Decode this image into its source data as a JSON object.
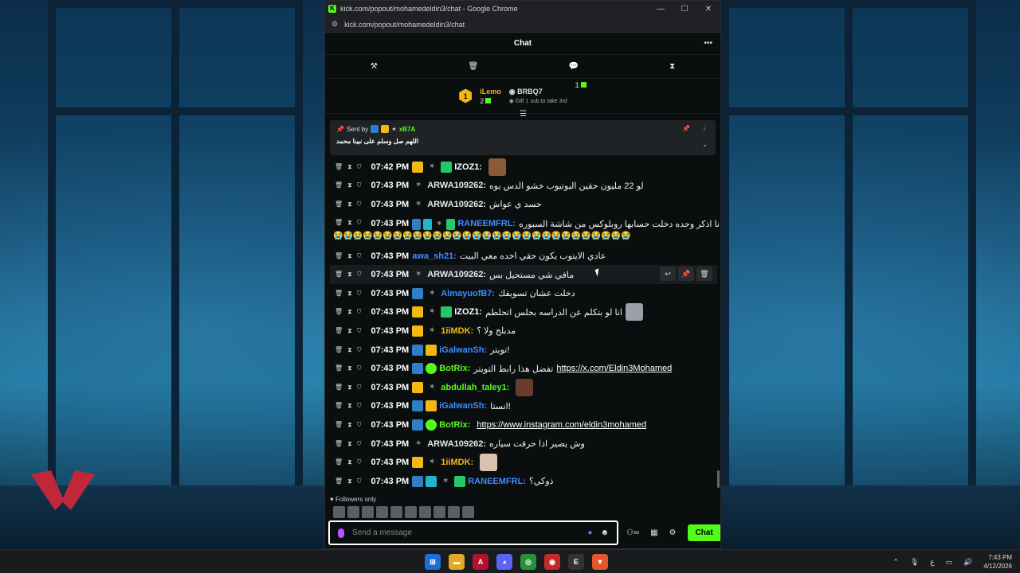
{
  "browser": {
    "title": "kick.com/popout/mohamedeldin3/chat - Google Chrome",
    "url": "kick.com/popout/mohamedeldin3/chat",
    "favicon_letter": "K"
  },
  "chat": {
    "header_title": "Chat",
    "more_glyph": "•••",
    "tools": [
      "⚒",
      "🗑",
      "💬",
      "⧗"
    ],
    "leaderboard": {
      "first_rank": "1",
      "first_name": "iLemo",
      "first_count": "2",
      "second_name": "BRBQ7",
      "second_hint": "Gift 1 sub to take 3rd",
      "third_count": "1"
    },
    "pinned": {
      "sent_by": "Sent by",
      "user": "xB7A",
      "text": "اللهم صل وسلم على نبينا محمد"
    },
    "messages": [
      {
        "time": "07:42 PM",
        "badges": [
          "crown",
          "gun",
          "sub"
        ],
        "user": "IZOZ1:",
        "user_color": "#ffffff",
        "text": "",
        "emote": "#8a5a3a"
      },
      {
        "time": "07:43 PM",
        "badges": [
          "gun"
        ],
        "user": "ARWA109262:",
        "user_color": "#e6e6e6",
        "text": "لو 22 مليون حقين اليوتيوب خشو الدس يوه"
      },
      {
        "time": "07:43 PM",
        "badges": [
          "gun"
        ],
        "user": "ARWA109262:",
        "user_color": "#e6e6e6",
        "text": "حسد ي عواش"
      },
      {
        "time": "07:43 PM",
        "badges": [
          "vip",
          "og",
          "gun",
          "sub"
        ],
        "user": "RANEEMFRL:",
        "user_color": "#3d8bff",
        "text": "انا اذكر وحده دخلت حسابها روبلوكس من شاشة السبوره",
        "wrap": "😭😭😭😭😭😭😭😭😭😭😭😭😭😭😭😭😭😭😭😭😭😭😭😭😭😭😭😭😭😭"
      },
      {
        "time": "07:43 PM",
        "badges": [],
        "user": "awa_sh21:",
        "user_color": "#3d8bff",
        "text": "عادي الايتوب يكون حقي اخده معي البيت"
      },
      {
        "time": "07:43 PM",
        "badges": [
          "gun"
        ],
        "user": "ARWA109262:",
        "user_color": "#e6e6e6",
        "text": "مافي شي مستحيل بس",
        "hover": true
      },
      {
        "time": "07:43 PM",
        "badges": [
          "vip",
          "gun"
        ],
        "user": "AlmayuofB7:",
        "user_color": "#3d8bff",
        "text": "دخلت عشان تسويقك"
      },
      {
        "time": "07:43 PM",
        "badges": [
          "crown",
          "gun",
          "sub"
        ],
        "user": "IZOZ1:",
        "user_color": "#ffffff",
        "text": "انا لو بتكلم عن الدراسه بجلس اتحلطم",
        "emote": "#9aa0a8"
      },
      {
        "time": "07:43 PM",
        "badges": [
          "crown",
          "gun"
        ],
        "user": "1iiMDK:",
        "user_color": "#f3b814",
        "text": "مدبلج ولا ؟"
      },
      {
        "time": "07:43 PM",
        "badges": [
          "vip",
          "crown"
        ],
        "user": "iGalwanSh:",
        "user_color": "#3d8bff",
        "text": "تويتر!"
      },
      {
        "time": "07:43 PM",
        "badges": [
          "vip",
          "verified"
        ],
        "user": "BotRix:",
        "user_color": "#53fc18",
        "text": "تفضل هذا رابط التويتر",
        "link": "https://x.com/Eldin3Mohamed"
      },
      {
        "time": "07:43 PM",
        "badges": [
          "crown",
          "gun"
        ],
        "user": "abdullah_taley1:",
        "user_color": "#53fc18",
        "text": "",
        "emote": "#6b3a2a"
      },
      {
        "time": "07:43 PM",
        "badges": [
          "vip",
          "crown"
        ],
        "user": "iGalwanSh:",
        "user_color": "#3d8bff",
        "text": "انستا!"
      },
      {
        "time": "07:43 PM",
        "badges": [
          "vip",
          "verified"
        ],
        "user": "BotRix:",
        "user_color": "#53fc18",
        "text": "",
        "link": "https://www.instagram.com/eldin3mohamed"
      },
      {
        "time": "07:43 PM",
        "badges": [
          "gun"
        ],
        "user": "ARWA109262:",
        "user_color": "#e6e6e6",
        "text": "وش يصير اذا حرقت سياره"
      },
      {
        "time": "07:43 PM",
        "badges": [
          "crown",
          "gun"
        ],
        "user": "1iiMDK:",
        "user_color": "#f3b814",
        "text": "",
        "emote": "#d8c2b0"
      },
      {
        "time": "07:43 PM",
        "badges": [
          "vip",
          "og",
          "gun",
          "sub"
        ],
        "user": "RANEEMFRL:",
        "user_color": "#3d8bff",
        "text": "ذوكي؟"
      }
    ],
    "followers_only": "Followers only",
    "composer_placeholder": "Send a message",
    "send_label": "Chat"
  },
  "taskbar": {
    "time": "7:43 PM",
    "date": "4/12/2026",
    "lang": "ع"
  },
  "colors": {
    "kick_green": "#53fc18",
    "bg": "#0b0e0f"
  }
}
